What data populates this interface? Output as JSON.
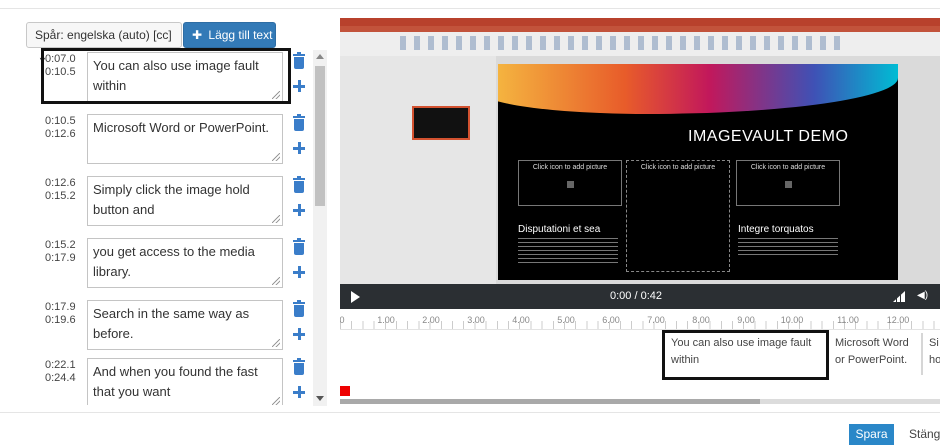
{
  "toolbar": {
    "track_select": "Spår: engelska (auto) [cc]",
    "add_text_label": "Lägg till text"
  },
  "cues": [
    {
      "start": "0:07.0",
      "end": "0:10.5",
      "text": "You can also use image fault within"
    },
    {
      "start": "0:10.5",
      "end": "0:12.6",
      "text": "Microsoft Word or PowerPoint."
    },
    {
      "start": "0:12.6",
      "end": "0:15.2",
      "text": "Simply click the image hold button and"
    },
    {
      "start": "0:15.2",
      "end": "0:17.9",
      "text": "you get access to the media library."
    },
    {
      "start": "0:17.9",
      "end": "0:19.6",
      "text": "Search in the same way as before."
    },
    {
      "start": "0:22.1",
      "end": "0:24.4",
      "text": "And when you found the fast that you want"
    }
  ],
  "video": {
    "slide_title": "IMAGEVAULT DEMO",
    "placeholder_text": "Click icon to add picture",
    "subtitle_left": "Disputationi et sea",
    "subtitle_right": "Integre torquatos"
  },
  "player": {
    "timecode": "0:00 / 0:42"
  },
  "timeline": {
    "ruler_labels": [
      "0",
      "1.00",
      "2.00",
      "3.00",
      "4.00",
      "5.00",
      "6.00",
      "7.00",
      "8.00",
      "9.00",
      "10.00",
      "11.00",
      "12.00"
    ],
    "blocks": [
      {
        "text": "You can also use image fault within"
      },
      {
        "text": "Microsoft Word or PowerPoint."
      },
      {
        "text": "Si ho"
      }
    ]
  },
  "footer": {
    "save_label": "Spara",
    "close_label": "Stäng"
  }
}
